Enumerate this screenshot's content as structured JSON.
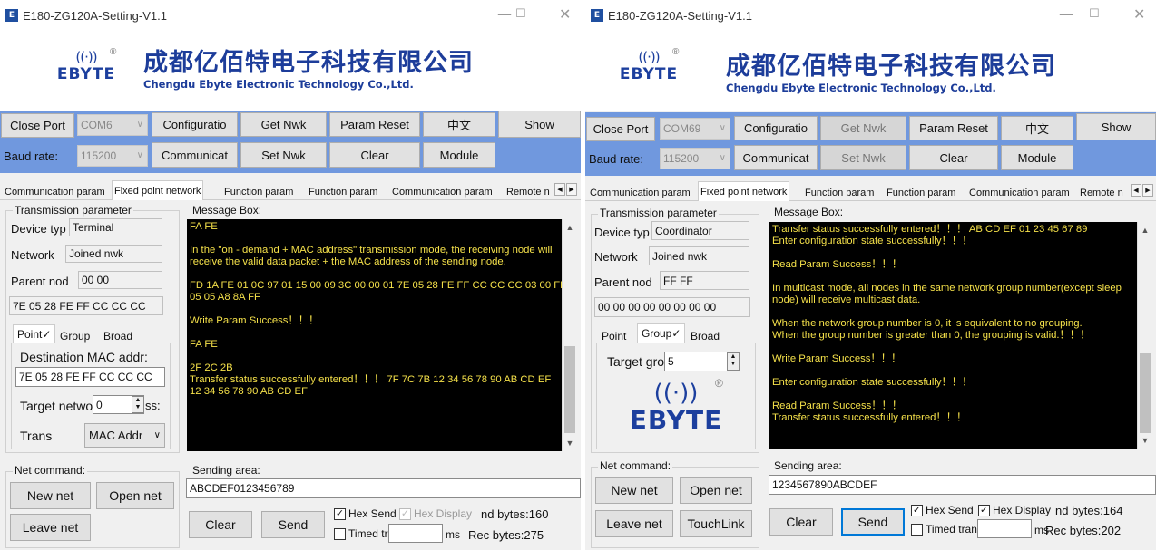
{
  "common": {
    "title": "E180-ZG120A-Setting-V1.1",
    "app_icon": "E",
    "logo_word": "EBYTE",
    "logo_reg": "®",
    "company_cn": "成都亿佰特电子科技有限公司",
    "company_en": "Chengdu Ebyte Electronic Technology Co.,Ltd.",
    "buttons": {
      "close_port": "Close Port",
      "configuration": "Configuratio",
      "get_nwk": "Get Nwk",
      "param_reset": "Param Reset",
      "chinese": "中文",
      "show": "Show",
      "communicat": "Communicat",
      "set_nwk": "Set Nwk",
      "clear": "Clear",
      "module": "Module",
      "new_net": "New net",
      "open_net": "Open net",
      "leave_net": "Leave net",
      "touchlink": "TouchLink",
      "send": "Send"
    },
    "labels": {
      "baud_rate": "Baud rate:",
      "transmission_parameter": "Transmission parameter",
      "device_type": "Device typ",
      "network": "Network",
      "parent_node": "Parent nod",
      "message_box": "Message Box:",
      "net_command": "Net command:",
      "sending_area": "Sending area:",
      "hex_send": "Hex Send",
      "hex_display": "Hex Display",
      "timed_tran": "Timed tran",
      "ms": "ms"
    },
    "tabs": [
      "Communication param",
      "Fixed point network",
      "Function param",
      "Function param",
      "Communication param"
    ],
    "tab_remote_w1": "Remote n",
    "tab_remote_w2": "Remote n",
    "subtabs": {
      "point": "Point",
      "point_checked": "Point✓",
      "group": "Group",
      "group_checked": "Group✓",
      "broad": "Broad"
    }
  },
  "window1": {
    "port": "COM6",
    "baud": "115200",
    "device_type": "Terminal",
    "network": "Joined nwk",
    "parent_node": "00 00",
    "long_addr": "7E 05 28 FE FF CC CC CC",
    "dest_mac_label": "Destination MAC addr:",
    "dest_mac": "7E 05 28 FE FF CC CC CC",
    "target_network_label": "Target netwo",
    "target_network_value": "0",
    "target_network_suffix": "ss:",
    "trans_label": "Trans",
    "trans_value": "MAC Addr",
    "messages": [
      "FA FE",
      "",
      "In the \"on - demand + MAC address\" transmission mode, the receiving node will receive the valid data packet + the MAC address of the sending node.",
      "",
      "FD 1A FE 01 0C 97 01 15 00 09 3C 00 00 01 7E 05 28 FE FF CC CC CC 03 00 FF 05 05 A8 8A FF",
      "",
      "Write Param Success！！！",
      "",
      "FA FE",
      "",
      "2F 2C 2B",
      "Transfer status successfully entered！！！ 7F 7C 7B 12 34 56 78 90 AB CD EF",
      "12 34 56 78 90 AB CD EF"
    ],
    "send_text": "ABCDEF0123456789",
    "hex_send_checked": true,
    "hex_display_checked": true,
    "timed_checked": false,
    "send_bytes": "nd bytes:160",
    "rec_bytes": "Rec bytes:275"
  },
  "window2": {
    "port": "COM69",
    "baud": "115200",
    "device_type": "Coordinator",
    "network": "Joined nwk",
    "parent_node": "FF FF",
    "long_addr": "00 00 00 00 00 00 00 00",
    "target_group_label": "Target gro",
    "target_group_value": "5",
    "messages": [
      "Transfer status successfully entered！！！ AB CD EF 01 23 45 67 89",
      "Enter configuration state successfully！！！",
      "",
      "Read Param Success！！！",
      "",
      "In multicast mode, all nodes in the same network group number(except sleep node) will receive multicast data.",
      "",
      "When the network group number is 0, it is equivalent to no grouping.",
      "When the group number is greater than 0, the grouping is valid.！！！",
      "",
      "Write Param Success！！！",
      "",
      "Enter configuration state successfully！！！",
      "",
      "Read Param Success！！！",
      "Transfer status successfully entered！！！"
    ],
    "send_text": "1234567890ABCDEF",
    "hex_send_checked": true,
    "hex_display_checked": true,
    "timed_checked": false,
    "send_bytes": "nd bytes:164",
    "rec_bytes": "Rec bytes:202"
  }
}
